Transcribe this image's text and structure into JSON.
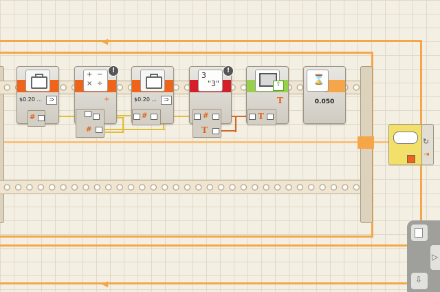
{
  "blocks": {
    "var1": {
      "icon": "briefcase-icon",
      "label": "$0.20 ..."
    },
    "math": {
      "icon": "math-operators-icon",
      "op_glyphs": [
        "+",
        "−",
        "×",
        "÷"
      ]
    },
    "var2": {
      "icon": "briefcase-icon",
      "label": "$0.20 ..."
    },
    "numtotext": {
      "icon": "number-to-text-icon",
      "line1": "3",
      "line2": "\"3\""
    },
    "display": {
      "icon": "display-icon"
    },
    "wait": {
      "icon": "hourglass-icon",
      "label": "0.050"
    }
  },
  "plugs": {
    "number_glyph": "#",
    "text_glyph": "T",
    "warning_glyph": "!"
  },
  "colors": {
    "sequence_beam": "#f5a649",
    "variable_band": "#f0641a",
    "math_band": "#f0641a",
    "convert_band": "#d41f2b",
    "display_band": "#97d14a",
    "wait_band": "#f5a649",
    "number_wire": "#e0be39",
    "text_wire": "#d4662a",
    "loop_end": "#f2e06a"
  }
}
